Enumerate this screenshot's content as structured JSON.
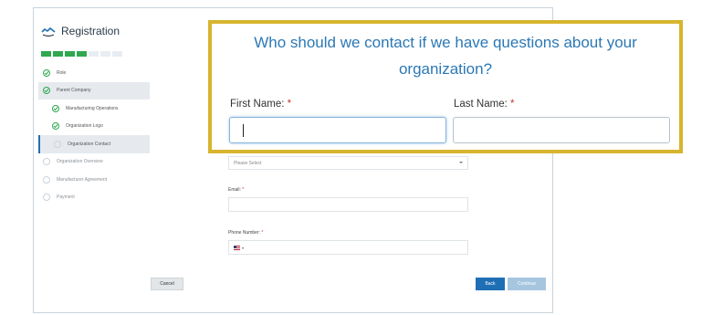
{
  "app": {
    "title": "Registration"
  },
  "progress": {
    "filled_segments": 4,
    "total_segments": 7
  },
  "steps": [
    {
      "label": "Role",
      "state": "done",
      "sub": false
    },
    {
      "label": "Parent Company",
      "state": "done",
      "sub": false
    },
    {
      "label": "Manufacturing Operations",
      "state": "done",
      "sub": true
    },
    {
      "label": "Organization Logo",
      "state": "done",
      "sub": true
    },
    {
      "label": "Organization Contact",
      "state": "current",
      "sub": true
    },
    {
      "label": "Organization Overview",
      "state": "todo",
      "sub": false
    },
    {
      "label": "Manufacturer Agreement",
      "state": "todo",
      "sub": false
    },
    {
      "label": "Payment",
      "state": "todo",
      "sub": false
    }
  ],
  "form": {
    "select": {
      "placeholder": "Please Select"
    },
    "email": {
      "label": "Email:",
      "required": "*"
    },
    "phone": {
      "label": "Phone Number:",
      "required": "*"
    }
  },
  "buttons": {
    "cancel": "Cancel",
    "back": "Back",
    "continue": "Continue"
  },
  "callout": {
    "question_line1": "Who should we contact if we have questions about your",
    "question_line2": "organization?",
    "first_name_label": "First Name:",
    "last_name_label": "Last Name:",
    "required_mark": "*"
  },
  "colors": {
    "accent": "#2b78b5",
    "success": "#2fa84f",
    "callout_border": "#d7b52e"
  }
}
